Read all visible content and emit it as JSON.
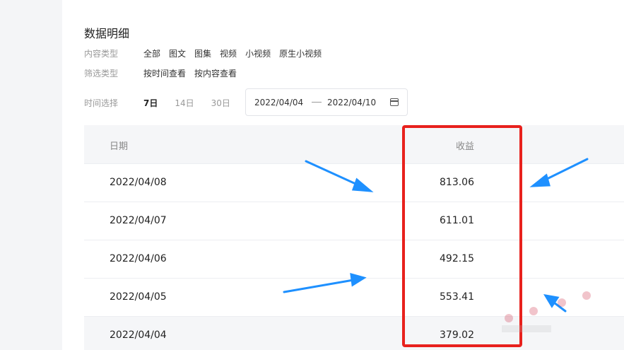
{
  "section_title": "数据明细",
  "content_type": {
    "label": "内容类型",
    "options": [
      "全部",
      "图文",
      "图集",
      "视频",
      "小视频",
      "原生小视频"
    ]
  },
  "filter_type": {
    "label": "筛选类型",
    "options": [
      "按时间查看",
      "按内容查看"
    ]
  },
  "time_select": {
    "label": "时间选择",
    "options": [
      "7日",
      "14日",
      "30日"
    ],
    "active": "7日"
  },
  "date_range": {
    "start": "2022/04/04",
    "end": "2022/04/10"
  },
  "table": {
    "headers": [
      "日期",
      "收益"
    ],
    "rows": [
      [
        "2022/04/08",
        "813.06"
      ],
      [
        "2022/04/07",
        "611.01"
      ],
      [
        "2022/04/06",
        "492.15"
      ],
      [
        "2022/04/05",
        "553.41"
      ],
      [
        "2022/04/04",
        "379.02"
      ]
    ]
  },
  "colors": {
    "highlight": "#e8211d",
    "arrow": "#1e90ff"
  }
}
